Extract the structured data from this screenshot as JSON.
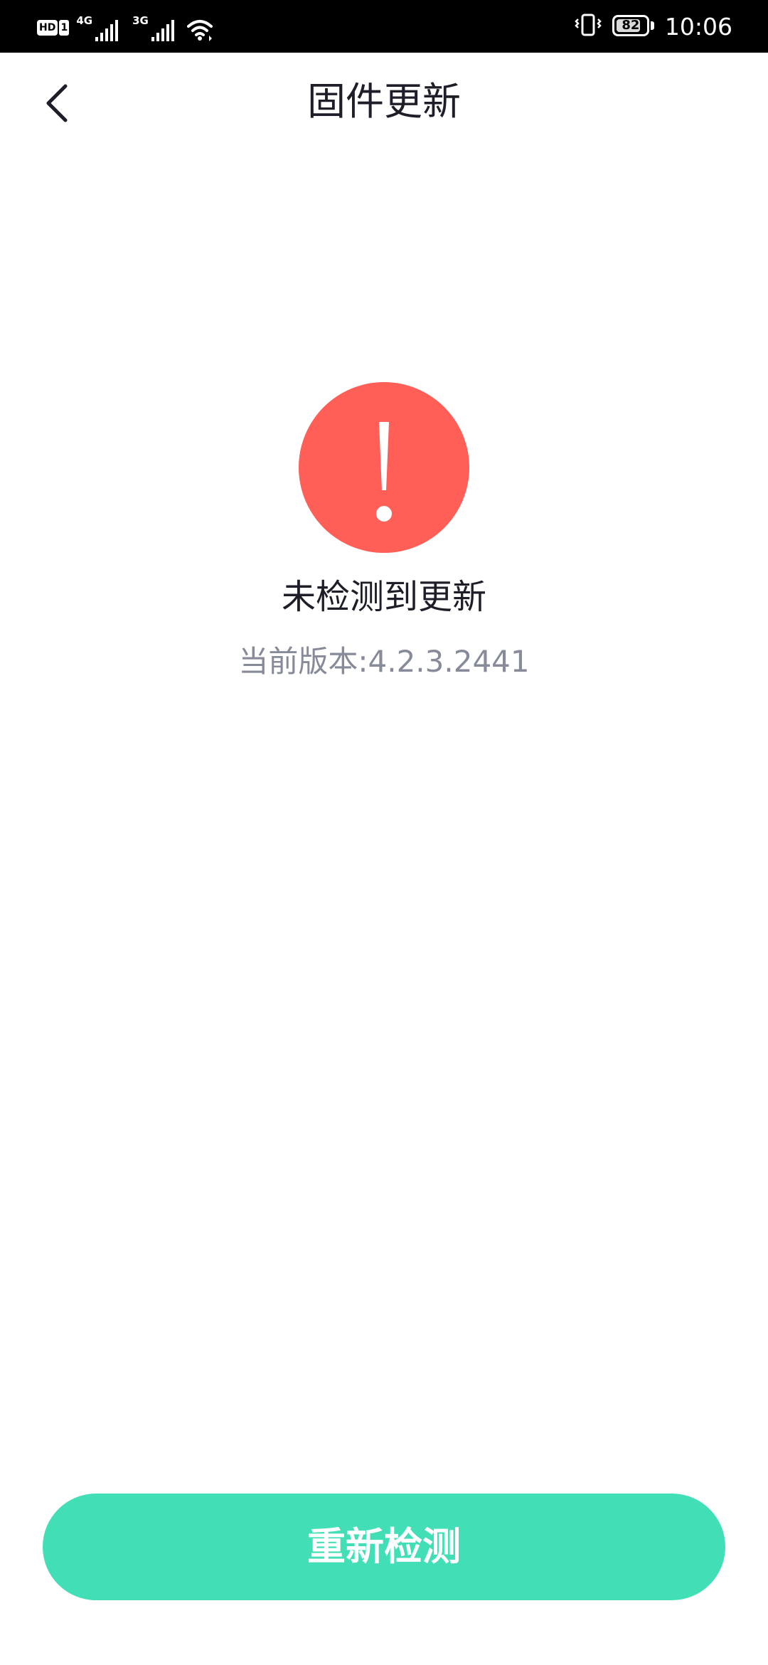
{
  "status_bar": {
    "hd_label": "HD",
    "sim_slot": "1",
    "network_1": "4G",
    "network_2": "3G",
    "battery_level": "82",
    "battery_fraction": 0.82,
    "time": "10:06",
    "icons": [
      "signal-icon",
      "wifi-icon",
      "vibrate-icon",
      "battery-icon"
    ]
  },
  "header": {
    "title": "固件更新",
    "back_icon": "chevron-left-icon"
  },
  "status": {
    "icon": "exclamation-circle-icon",
    "icon_color": "#ff5f57",
    "title": "未检测到更新",
    "version_text": "当前版本:4.2.3.2441"
  },
  "actions": {
    "recheck_label": "重新检测",
    "recheck_color": "#42dfb7"
  }
}
